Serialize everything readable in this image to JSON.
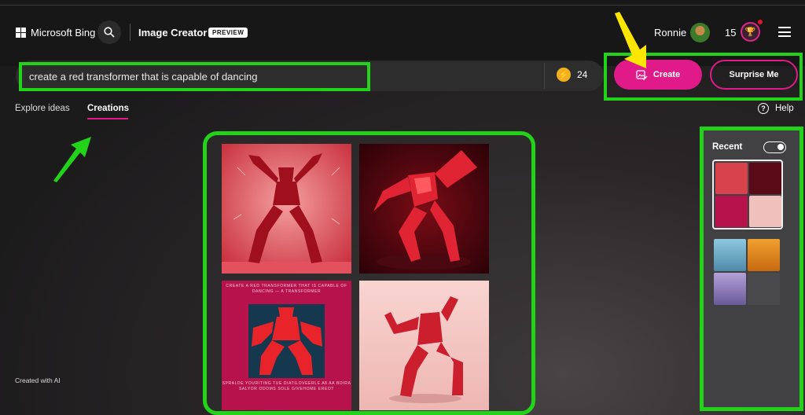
{
  "header": {
    "logo_text": "Microsoft Bing",
    "app_name": "Image Creator",
    "badge": "PREVIEW",
    "user_name": "Ronnie",
    "points": "15"
  },
  "prompt": {
    "value": "create a red transformer that is capable of dancing",
    "boost_count": "24"
  },
  "actions": {
    "create_label": "Create",
    "surprise_label": "Surprise Me"
  },
  "tabs": [
    {
      "label": "Explore ideas",
      "active": false
    },
    {
      "label": "Creations",
      "active": true
    }
  ],
  "help_label": "Help",
  "results": {
    "poster_top_text": "CREATE A RED TRANSFORMER THAT IS CAPABLE OF DANCING — A TRANSFORMER",
    "poster_bottom_text": "SPRALDE YOURITING TUE DIATILOVEERLE A8 AA BOIRA SALYOR ODOMS SOLE GIVEHOME EREOT"
  },
  "recent": {
    "label": "Recent"
  },
  "footer_text": "Created with AI",
  "colors": {
    "accent_pink": "#e01a88",
    "annotation_green": "#22d31a",
    "annotation_yellow": "#ffe600"
  }
}
